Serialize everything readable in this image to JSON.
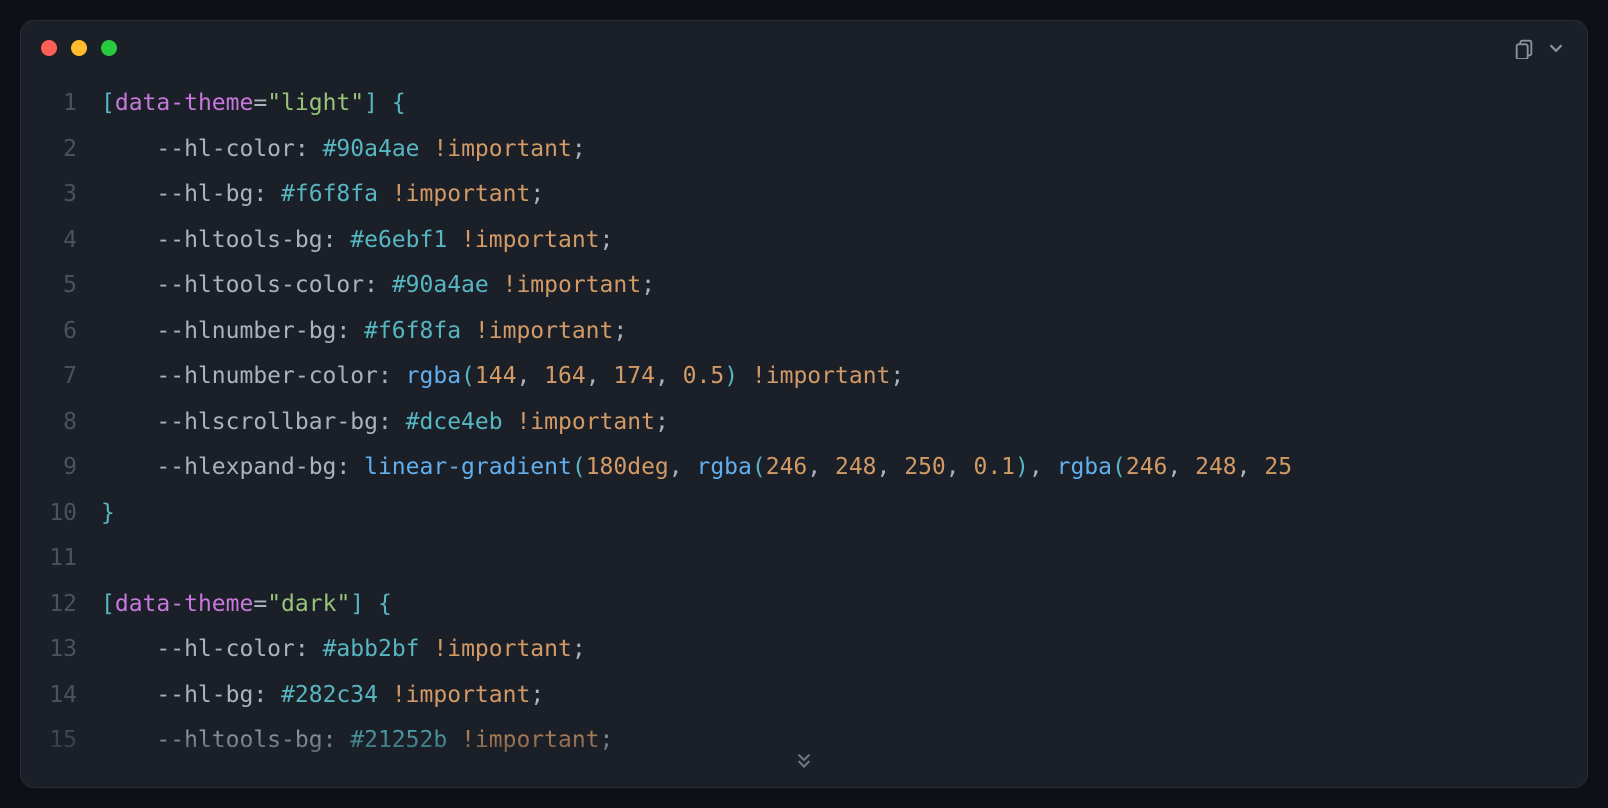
{
  "colors": {
    "red": "#ff5f56",
    "yellow": "#ffbd2e",
    "green": "#27c93f",
    "bg": "#1b1f27",
    "gutter": "#4a5260"
  },
  "code": {
    "lines": [
      {
        "n": "1",
        "tokens": [
          [
            "br",
            "["
          ],
          [
            "kw",
            "data-theme"
          ],
          [
            "pn",
            "="
          ],
          [
            "st",
            "\"light\""
          ],
          [
            "br",
            "]"
          ],
          [
            "pn",
            " "
          ],
          [
            "br",
            "{"
          ]
        ]
      },
      {
        "n": "2",
        "tokens": [
          [
            "pn",
            "    "
          ],
          [
            "pr",
            "--hl-color"
          ],
          [
            "pn",
            ": "
          ],
          [
            "vl",
            "#90a4ae"
          ],
          [
            "pn",
            " "
          ],
          [
            "im",
            "!important"
          ],
          [
            "pn",
            ";"
          ]
        ]
      },
      {
        "n": "3",
        "tokens": [
          [
            "pn",
            "    "
          ],
          [
            "pr",
            "--hl-bg"
          ],
          [
            "pn",
            ": "
          ],
          [
            "vl",
            "#f6f8fa"
          ],
          [
            "pn",
            " "
          ],
          [
            "im",
            "!important"
          ],
          [
            "pn",
            ";"
          ]
        ]
      },
      {
        "n": "4",
        "tokens": [
          [
            "pn",
            "    "
          ],
          [
            "pr",
            "--hltools-bg"
          ],
          [
            "pn",
            ": "
          ],
          [
            "vl",
            "#e6ebf1"
          ],
          [
            "pn",
            " "
          ],
          [
            "im",
            "!important"
          ],
          [
            "pn",
            ";"
          ]
        ]
      },
      {
        "n": "5",
        "tokens": [
          [
            "pn",
            "    "
          ],
          [
            "pr",
            "--hltools-color"
          ],
          [
            "pn",
            ": "
          ],
          [
            "vl",
            "#90a4ae"
          ],
          [
            "pn",
            " "
          ],
          [
            "im",
            "!important"
          ],
          [
            "pn",
            ";"
          ]
        ]
      },
      {
        "n": "6",
        "tokens": [
          [
            "pn",
            "    "
          ],
          [
            "pr",
            "--hlnumber-bg"
          ],
          [
            "pn",
            ": "
          ],
          [
            "vl",
            "#f6f8fa"
          ],
          [
            "pn",
            " "
          ],
          [
            "im",
            "!important"
          ],
          [
            "pn",
            ";"
          ]
        ]
      },
      {
        "n": "7",
        "tokens": [
          [
            "pn",
            "    "
          ],
          [
            "pr",
            "--hlnumber-color"
          ],
          [
            "pn",
            ": "
          ],
          [
            "fn",
            "rgba"
          ],
          [
            "br",
            "("
          ],
          [
            "nm",
            "144"
          ],
          [
            "pn",
            ", "
          ],
          [
            "nm",
            "164"
          ],
          [
            "pn",
            ", "
          ],
          [
            "nm",
            "174"
          ],
          [
            "pn",
            ", "
          ],
          [
            "nm",
            "0.5"
          ],
          [
            "br",
            ")"
          ],
          [
            "pn",
            " "
          ],
          [
            "im",
            "!important"
          ],
          [
            "pn",
            ";"
          ]
        ]
      },
      {
        "n": "8",
        "tokens": [
          [
            "pn",
            "    "
          ],
          [
            "pr",
            "--hlscrollbar-bg"
          ],
          [
            "pn",
            ": "
          ],
          [
            "vl",
            "#dce4eb"
          ],
          [
            "pn",
            " "
          ],
          [
            "im",
            "!important"
          ],
          [
            "pn",
            ";"
          ]
        ]
      },
      {
        "n": "9",
        "tokens": [
          [
            "pn",
            "    "
          ],
          [
            "pr",
            "--hlexpand-bg"
          ],
          [
            "pn",
            ": "
          ],
          [
            "fn",
            "linear-gradient"
          ],
          [
            "br",
            "("
          ],
          [
            "nm",
            "180deg"
          ],
          [
            "pn",
            ", "
          ],
          [
            "fn",
            "rgba"
          ],
          [
            "br",
            "("
          ],
          [
            "nm",
            "246"
          ],
          [
            "pn",
            ", "
          ],
          [
            "nm",
            "248"
          ],
          [
            "pn",
            ", "
          ],
          [
            "nm",
            "250"
          ],
          [
            "pn",
            ", "
          ],
          [
            "nm",
            "0.1"
          ],
          [
            "br",
            ")"
          ],
          [
            "pn",
            ", "
          ],
          [
            "fn",
            "rgba"
          ],
          [
            "br",
            "("
          ],
          [
            "nm",
            "246"
          ],
          [
            "pn",
            ", "
          ],
          [
            "nm",
            "248"
          ],
          [
            "pn",
            ", "
          ],
          [
            "nm",
            "25"
          ]
        ]
      },
      {
        "n": "10",
        "tokens": [
          [
            "br",
            "}"
          ]
        ]
      },
      {
        "n": "11",
        "tokens": [
          [
            "pn",
            ""
          ]
        ]
      },
      {
        "n": "12",
        "tokens": [
          [
            "br",
            "["
          ],
          [
            "kw",
            "data-theme"
          ],
          [
            "pn",
            "="
          ],
          [
            "st",
            "\"dark\""
          ],
          [
            "br",
            "]"
          ],
          [
            "pn",
            " "
          ],
          [
            "br",
            "{"
          ]
        ]
      },
      {
        "n": "13",
        "tokens": [
          [
            "pn",
            "    "
          ],
          [
            "pr",
            "--hl-color"
          ],
          [
            "pn",
            ": "
          ],
          [
            "vl",
            "#abb2bf"
          ],
          [
            "pn",
            " "
          ],
          [
            "im",
            "!important"
          ],
          [
            "pn",
            ";"
          ]
        ]
      },
      {
        "n": "14",
        "tokens": [
          [
            "pn",
            "    "
          ],
          [
            "pr",
            "--hl-bg"
          ],
          [
            "pn",
            ": "
          ],
          [
            "vl",
            "#282c34"
          ],
          [
            "pn",
            " "
          ],
          [
            "im",
            "!important"
          ],
          [
            "pn",
            ";"
          ]
        ]
      },
      {
        "n": "15",
        "tokens": [
          [
            "pn",
            "    "
          ],
          [
            "pr",
            "--hltools-bg"
          ],
          [
            "pn",
            ": "
          ],
          [
            "vl",
            "#21252b"
          ],
          [
            "pn",
            " "
          ],
          [
            "im",
            "!important"
          ],
          [
            "pn",
            ";"
          ]
        ]
      }
    ]
  }
}
